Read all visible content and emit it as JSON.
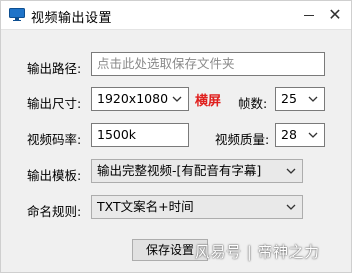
{
  "window": {
    "title": "视频输出设置",
    "minimize": "—",
    "close": "✕"
  },
  "output_path": {
    "label": "输出路径:",
    "placeholder": "点击此处选取保存文件夹",
    "value": ""
  },
  "output_size": {
    "label": "输出尺寸:",
    "value": "1920x1080",
    "orientation": "横屏"
  },
  "fps": {
    "label": "帧数:",
    "value": "25"
  },
  "bitrate": {
    "label": "视频码率:",
    "value": "1500k"
  },
  "quality": {
    "label": "视频质量:",
    "value": "28"
  },
  "template": {
    "label": "输出模板:",
    "value": "输出完整视频-[有配音有字幕]"
  },
  "naming": {
    "label": "命名规则:",
    "value": "TXT文案名+时间"
  },
  "save_button": {
    "label": "保存设置"
  },
  "watermark": "风易号 | 帝神之力",
  "colors": {
    "accent_red": "#e0201e"
  }
}
